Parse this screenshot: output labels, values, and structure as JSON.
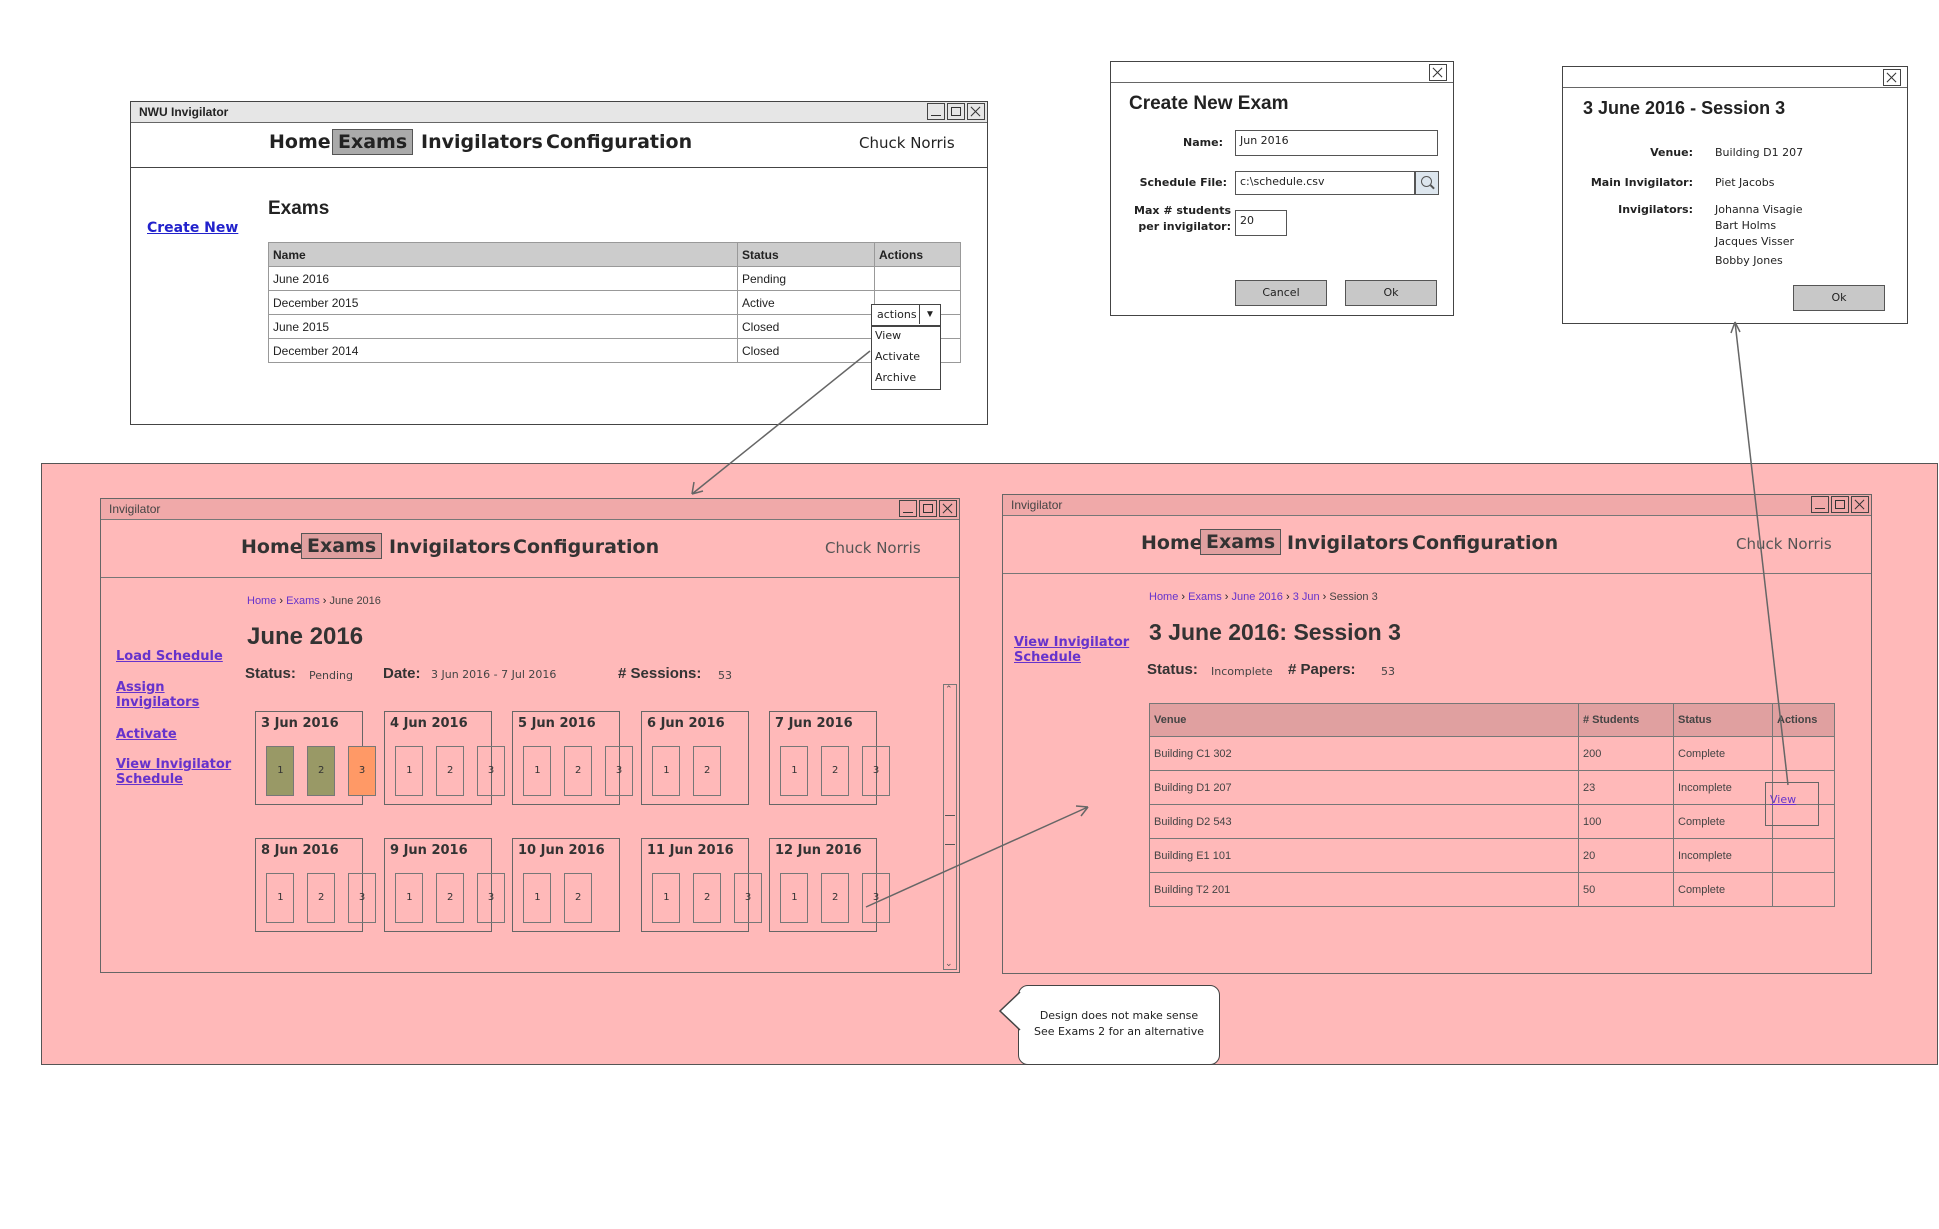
{
  "top_window": {
    "title": "NWU Invigilator",
    "nav": [
      "Home",
      "Exams",
      "Invigilators",
      "Configuration"
    ],
    "user": "Chuck Norris",
    "create_new": "Create New",
    "heading": "Exams",
    "columns": [
      "Name",
      "Status",
      "Actions"
    ],
    "rows": [
      {
        "name": "June 2016",
        "status": "Pending"
      },
      {
        "name": "December 2015",
        "status": "Active"
      },
      {
        "name": "June 2015",
        "status": "Closed"
      },
      {
        "name": "December 2014",
        "status": "Closed"
      }
    ],
    "actions_dropdown": "actions",
    "actions_menu": [
      "View",
      "Activate",
      "Archive"
    ]
  },
  "create_dialog": {
    "title": "Create New Exam",
    "name_label": "Name:",
    "name_value": "Jun 2016",
    "schedule_label": "Schedule File:",
    "schedule_value": "c:\\schedule.csv",
    "max_label_1": "Max # students",
    "max_label_2": "per invigilator:",
    "max_value": "20",
    "cancel": "Cancel",
    "ok": "Ok"
  },
  "session_dialog": {
    "title": "3 June 2016 - Session 3",
    "venue_label": "Venue:",
    "venue": "Building D1 207",
    "main_label": "Main Invigilator:",
    "main": "Piet Jacobs",
    "invig_label": "Invigilators:",
    "invigilators": [
      "Johanna Visagie",
      "Bart Holms",
      "Jacques Visser",
      "Bobby Jones"
    ],
    "ok": "Ok"
  },
  "june_window": {
    "title": "Invigilator",
    "nav": [
      "Home",
      "Exams",
      "Invigilators",
      "Configuration"
    ],
    "user": "Chuck Norris",
    "breadcrumb": [
      "Home",
      "Exams",
      "June 2016"
    ],
    "heading": "June 2016",
    "status_label": "Status:",
    "status": "Pending",
    "date_label": "Date:",
    "date": "3 Jun 2016 - 7 Jul 2016",
    "sessions_label": "# Sessions:",
    "sessions": "53",
    "links": [
      "Load Schedule",
      "Assign Invigilators",
      "Activate",
      "View Invigilator Schedule"
    ],
    "days": [
      {
        "label": "3 Jun 2016",
        "sessions": [
          "1",
          "2",
          "3"
        ]
      },
      {
        "label": "4 Jun 2016",
        "sessions": [
          "1",
          "2",
          "3"
        ]
      },
      {
        "label": "5 Jun 2016",
        "sessions": [
          "1",
          "2",
          "3"
        ]
      },
      {
        "label": "6 Jun 2016",
        "sessions": [
          "1",
          "2"
        ]
      },
      {
        "label": "7 Jun 2016",
        "sessions": [
          "1",
          "2",
          "3"
        ]
      },
      {
        "label": "8 Jun 2016",
        "sessions": [
          "1",
          "2",
          "3"
        ]
      },
      {
        "label": "9 Jun 2016",
        "sessions": [
          "1",
          "2",
          "3"
        ]
      },
      {
        "label": "10 Jun 2016",
        "sessions": [
          "1",
          "2"
        ]
      },
      {
        "label": "11 Jun 2016",
        "sessions": [
          "1",
          "2",
          "3"
        ]
      },
      {
        "label": "12 Jun 2016",
        "sessions": [
          "1",
          "2",
          "3"
        ]
      }
    ],
    "session_colors": [
      "#999966",
      "#999966",
      "#ff9966"
    ]
  },
  "session_window": {
    "title": "Invigilator",
    "nav": [
      "Home",
      "Exams",
      "Invigilators",
      "Configuration"
    ],
    "user": "Chuck Norris",
    "breadcrumb": [
      "Home",
      "Exams",
      "June 2016",
      "3 Jun",
      "Session 3"
    ],
    "heading": "3 June 2016: Session 3",
    "status_label": "Status:",
    "status": "Incomplete",
    "papers_label": "# Papers:",
    "papers": "53",
    "link": "View Invigilator Schedule",
    "columns": [
      "Venue",
      "# Students",
      "Status",
      "Actions"
    ],
    "rows": [
      {
        "venue": "Building C1 302",
        "students": "200",
        "status": "Complete"
      },
      {
        "venue": "Building D1 207",
        "students": "23",
        "status": "Incomplete"
      },
      {
        "venue": "Building D2 543",
        "students": "100",
        "status": "Complete"
      },
      {
        "venue": "Building E1 101",
        "students": "20",
        "status": "Incomplete"
      },
      {
        "venue": "Building T2 201",
        "students": "50",
        "status": "Complete"
      }
    ],
    "view_link": "View"
  },
  "note": {
    "line1": "Design does not make sense",
    "line2": "See Exams 2 for an alternative"
  },
  "colors": {
    "pink": "#ffb9b9",
    "pink_header": "#e6a0a0",
    "link": "#2222cc"
  }
}
